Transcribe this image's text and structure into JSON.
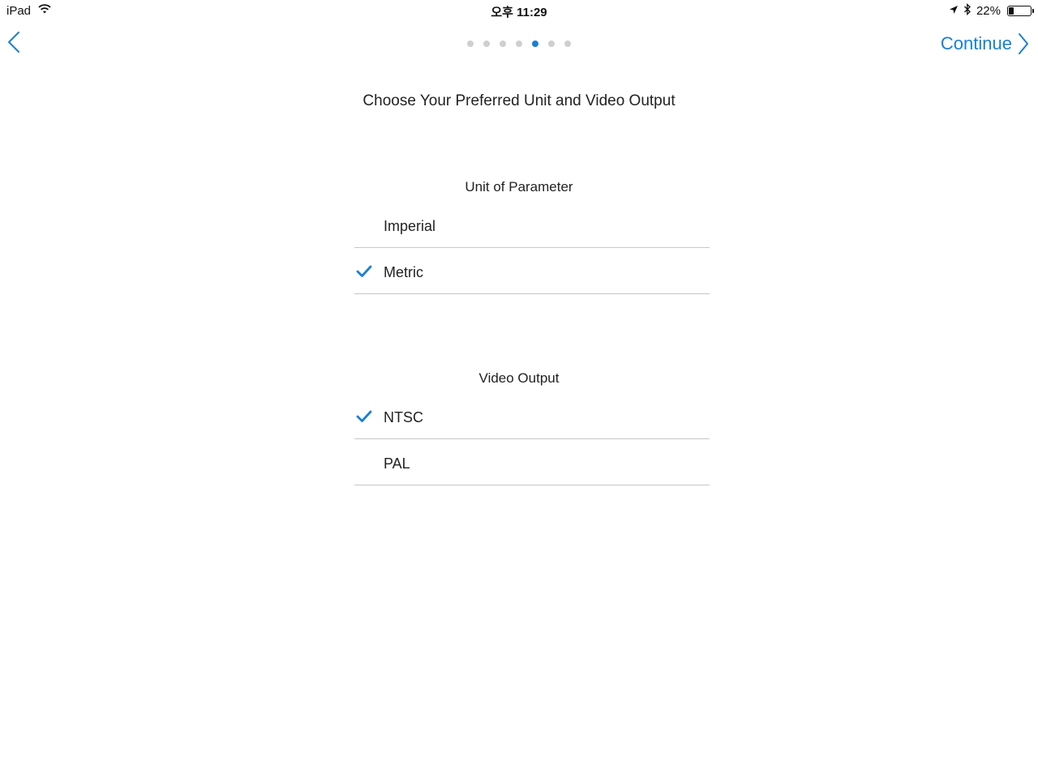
{
  "status_bar": {
    "device": "iPad",
    "time": "오후 11:29",
    "battery": "22%",
    "battery_level": 0.22,
    "icons": [
      "wifi-icon",
      "location-arrow-icon",
      "bluetooth-icon",
      "battery-icon"
    ]
  },
  "nav": {
    "back_icon": "chevron-left-icon",
    "continue_label": "Continue",
    "continue_icon": "chevron-right-icon",
    "pages_total": 7,
    "current_page": 5
  },
  "title": "Choose Your Preferred Unit and Video Output",
  "unit_section": {
    "heading": "Unit of Parameter",
    "options": [
      {
        "label": "Imperial",
        "selected": false
      },
      {
        "label": "Metric",
        "selected": true
      }
    ]
  },
  "video_section": {
    "heading": "Video Output",
    "options": [
      {
        "label": "NTSC",
        "selected": true
      },
      {
        "label": "PAL",
        "selected": false
      }
    ]
  },
  "colors": {
    "accent": "#1a7fd4",
    "dot_inactive": "#cfcfcf",
    "divider": "#c8c8c8"
  }
}
